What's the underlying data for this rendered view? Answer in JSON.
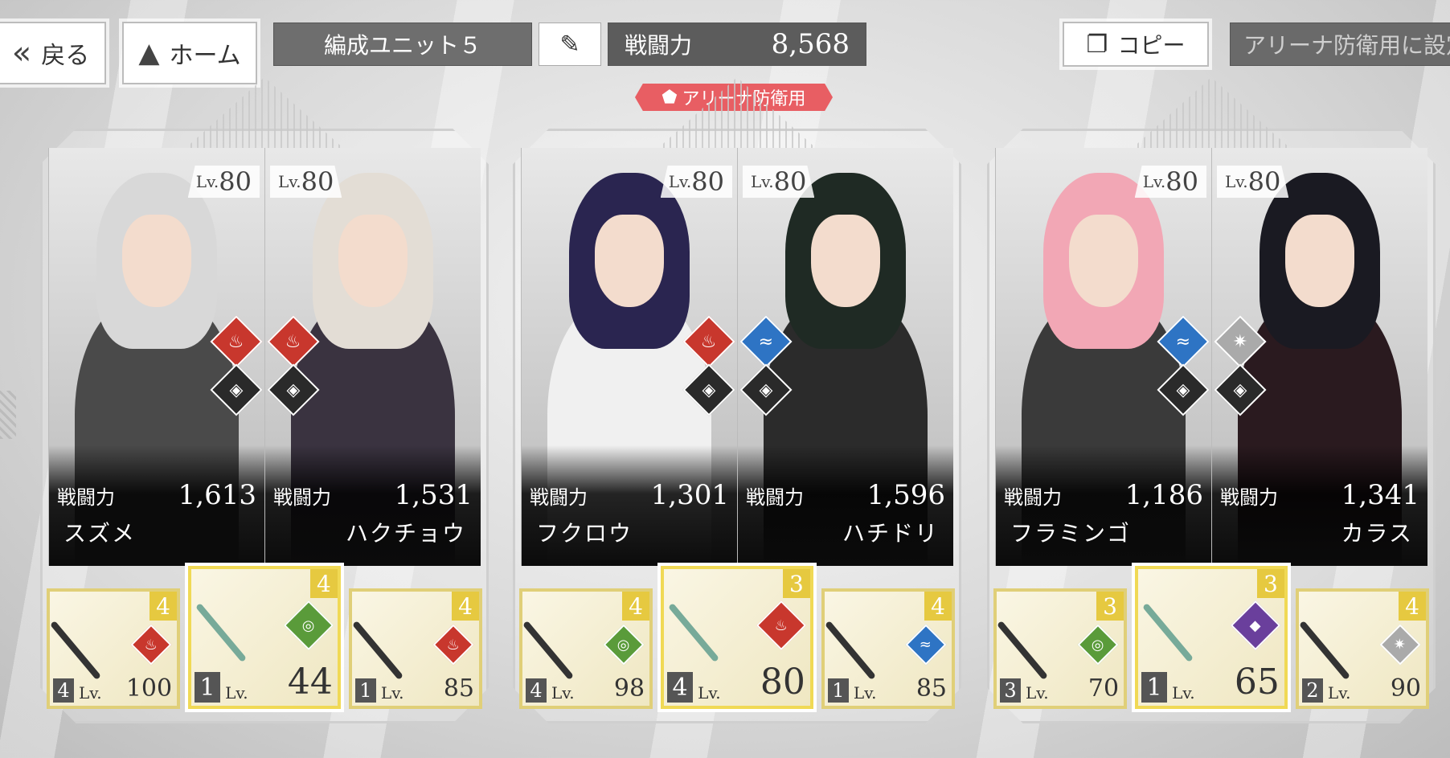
{
  "top": {
    "back_label": "戻る",
    "home_label": "ホーム",
    "unit_name": "編成ユニット５",
    "power_label": "戦闘力",
    "power_value": "8,568",
    "copy_label": "コピー",
    "arena_setting": "アリーナ防衛用に設定",
    "arena_badge": "アリーナ防衛用"
  },
  "teams": [
    {
      "chars": [
        {
          "name": "スズメ",
          "lv": "80",
          "power": "1,613",
          "element": "fire"
        },
        {
          "name": "ハクチョウ",
          "lv": "80",
          "power": "1,531",
          "element": "fire"
        }
      ],
      "weapons": [
        {
          "star": "4",
          "rank": "4",
          "lv": "100",
          "element": "fire"
        },
        {
          "star": "4",
          "rank": "1",
          "lv": "44",
          "element": "wind"
        },
        {
          "star": "4",
          "rank": "1",
          "lv": "85",
          "element": "fire"
        }
      ]
    },
    {
      "chars": [
        {
          "name": "フクロウ",
          "lv": "80",
          "power": "1,301",
          "element": "fire"
        },
        {
          "name": "ハチドリ",
          "lv": "80",
          "power": "1,596",
          "element": "water"
        }
      ],
      "weapons": [
        {
          "star": "4",
          "rank": "4",
          "lv": "98",
          "element": "wind"
        },
        {
          "star": "3",
          "rank": "4",
          "lv": "80",
          "element": "fire"
        },
        {
          "star": "4",
          "rank": "1",
          "lv": "85",
          "element": "water"
        }
      ]
    },
    {
      "chars": [
        {
          "name": "フラミンゴ",
          "lv": "80",
          "power": "1,186",
          "element": "water"
        },
        {
          "name": "カラス",
          "lv": "80",
          "power": "1,341",
          "element": "light"
        }
      ],
      "weapons": [
        {
          "star": "3",
          "rank": "3",
          "lv": "70",
          "element": "wind"
        },
        {
          "star": "3",
          "rank": "1",
          "lv": "65",
          "element": "dark"
        },
        {
          "star": "4",
          "rank": "2",
          "lv": "90",
          "element": "light"
        }
      ]
    }
  ],
  "labels": {
    "lv_prefix": "Lv.",
    "power_label": "戦闘力"
  },
  "icons": {
    "fire": "fire-icon",
    "water": "water-icon",
    "wind": "wind-icon",
    "light": "light-icon",
    "dark": "dark-icon"
  },
  "colors": {
    "fire": "#c8372d",
    "water": "#2e74c4",
    "wind": "#5a9b3a",
    "light": "#aaaaaa",
    "dark": "#6a3f9c",
    "arena_badge": "#e85e63"
  }
}
